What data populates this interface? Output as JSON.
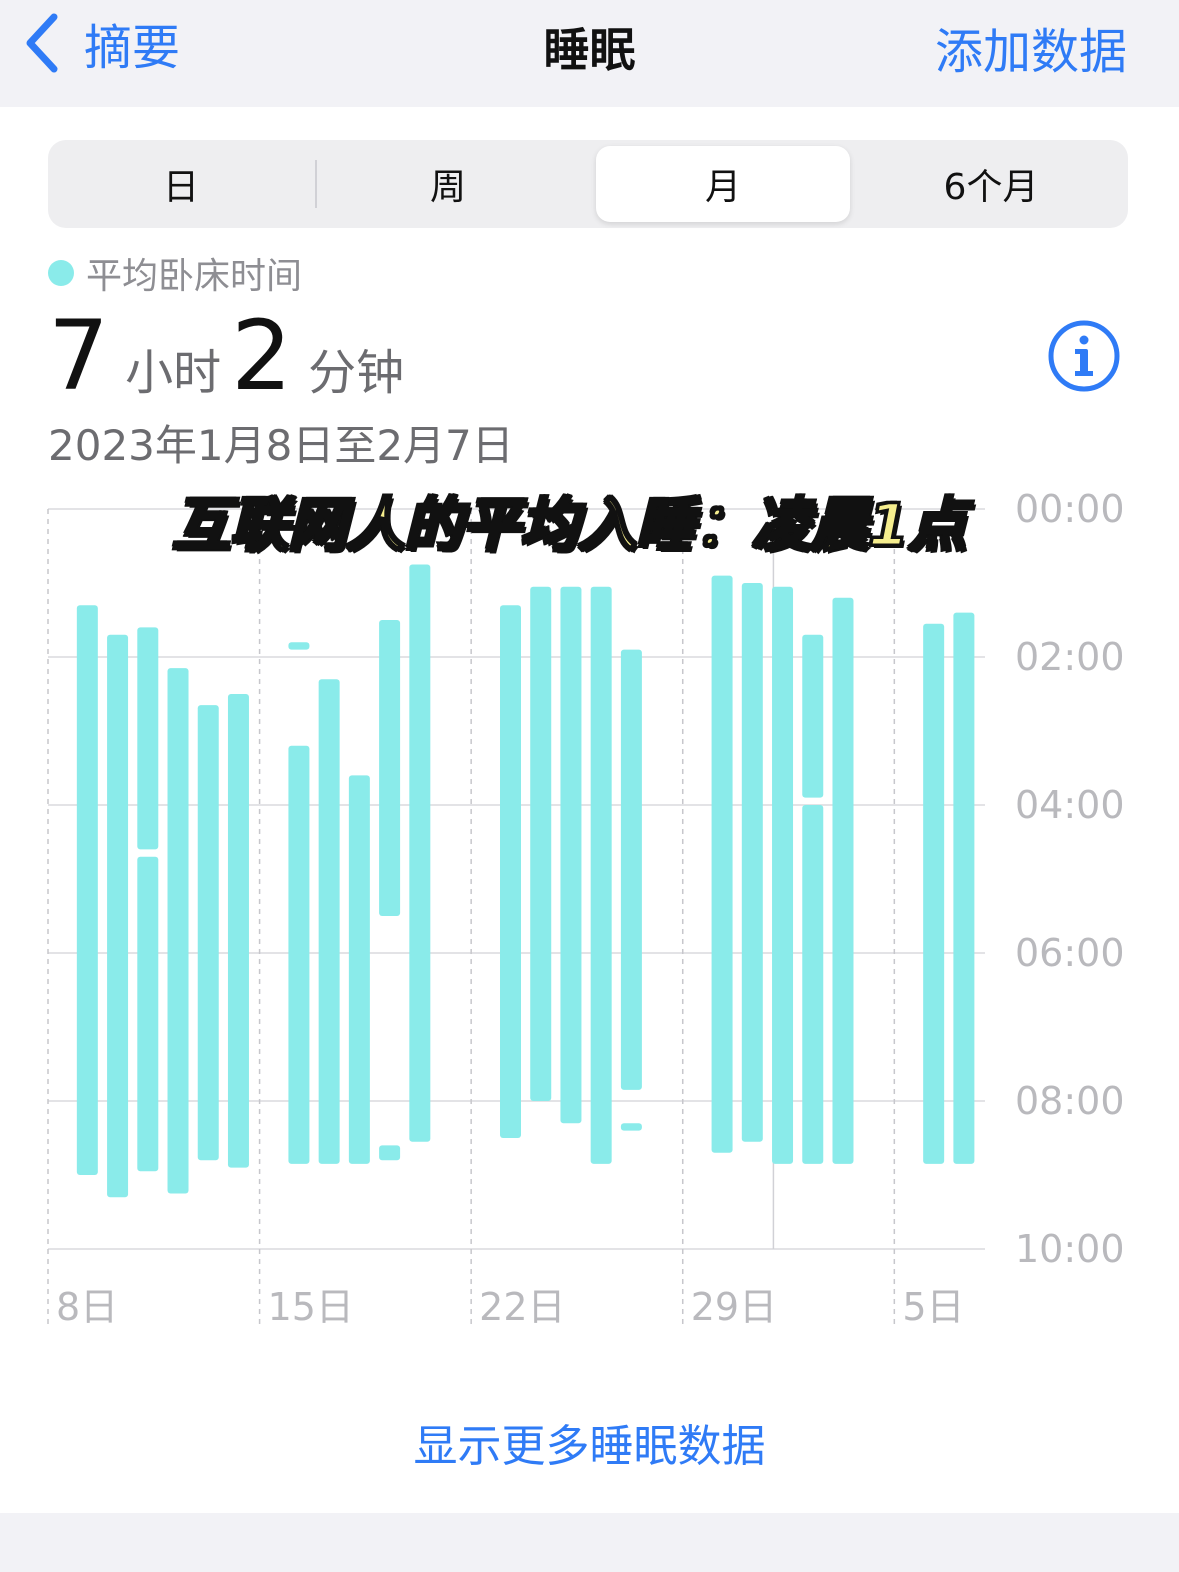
{
  "nav": {
    "back_label": "摘要",
    "title": "睡眠",
    "add_label": "添加数据"
  },
  "segments": [
    {
      "label": "日",
      "active": false
    },
    {
      "label": "周",
      "active": false
    },
    {
      "label": "月",
      "active": true
    },
    {
      "label": "6个月",
      "active": false
    }
  ],
  "summary": {
    "legend_label": "平均卧床时间",
    "hours": "7",
    "hours_unit": "小时",
    "minutes": "2",
    "minutes_unit": "分钟",
    "date_range": "2023年1月8日至2月7日"
  },
  "overlay_caption": "互联网人的平均入睡：凌晨1点",
  "more_button": "显示更多睡眠数据",
  "colors": {
    "accent": "#2f7bf6",
    "bar": "#8aebea",
    "gray_text": "#8e8e93"
  },
  "chart_data": {
    "type": "bar",
    "description_axis": "time of night, 00:00 at top to 10:00 at bottom",
    "y_tick_labels": [
      "00:00",
      "02:00",
      "04:00",
      "06:00",
      "08:00",
      "10:00"
    ],
    "y_range_hours": [
      0,
      10
    ],
    "x_tick_labels": [
      "8日",
      "15日",
      "22日",
      "29日",
      "5日"
    ],
    "x_tick_days": [
      0,
      7,
      14,
      21,
      28
    ],
    "days_total": 31,
    "series": [
      {
        "points": [
          {
            "day": 1,
            "segments": [
              [
                1.3,
                9.0
              ]
            ]
          },
          {
            "day": 2,
            "segments": [
              [
                1.7,
                9.3
              ]
            ]
          },
          {
            "day": 3,
            "segments": [
              [
                1.6,
                4.6
              ],
              [
                4.7,
                8.95
              ]
            ]
          },
          {
            "day": 4,
            "segments": [
              [
                2.15,
                9.25
              ]
            ]
          },
          {
            "day": 5,
            "segments": [
              [
                2.65,
                8.8
              ]
            ]
          },
          {
            "day": 6,
            "segments": [
              [
                2.5,
                8.9
              ]
            ]
          },
          {
            "day": 8,
            "segments": [
              [
                1.8,
                1.9
              ],
              [
                3.2,
                8.85
              ]
            ]
          },
          {
            "day": 9,
            "segments": [
              [
                2.3,
                8.85
              ]
            ]
          },
          {
            "day": 10,
            "segments": [
              [
                3.6,
                8.85
              ]
            ]
          },
          {
            "day": 11,
            "segments": [
              [
                1.5,
                5.5
              ],
              [
                8.6,
                8.8
              ]
            ]
          },
          {
            "day": 12,
            "segments": [
              [
                0.75,
                8.55
              ]
            ]
          },
          {
            "day": 15,
            "segments": [
              [
                1.3,
                8.5
              ]
            ]
          },
          {
            "day": 16,
            "segments": [
              [
                1.05,
                8.0
              ]
            ]
          },
          {
            "day": 17,
            "segments": [
              [
                1.05,
                8.3
              ]
            ]
          },
          {
            "day": 18,
            "segments": [
              [
                1.05,
                8.85
              ]
            ]
          },
          {
            "day": 19,
            "segments": [
              [
                1.9,
                7.85
              ],
              [
                8.3,
                8.4
              ]
            ]
          },
          {
            "day": 22,
            "segments": [
              [
                0.9,
                8.7
              ]
            ]
          },
          {
            "day": 23,
            "segments": [
              [
                1.0,
                8.55
              ]
            ]
          },
          {
            "day": 24,
            "segments": [
              [
                1.05,
                8.85
              ]
            ]
          },
          {
            "day": 25,
            "segments": [
              [
                1.7,
                3.9
              ],
              [
                4.0,
                8.85
              ]
            ]
          },
          {
            "day": 26,
            "segments": [
              [
                1.2,
                8.85
              ]
            ]
          },
          {
            "day": 29,
            "segments": [
              [
                1.55,
                8.85
              ]
            ]
          },
          {
            "day": 30,
            "segments": [
              [
                1.4,
                8.85
              ]
            ]
          }
        ]
      }
    ]
  }
}
